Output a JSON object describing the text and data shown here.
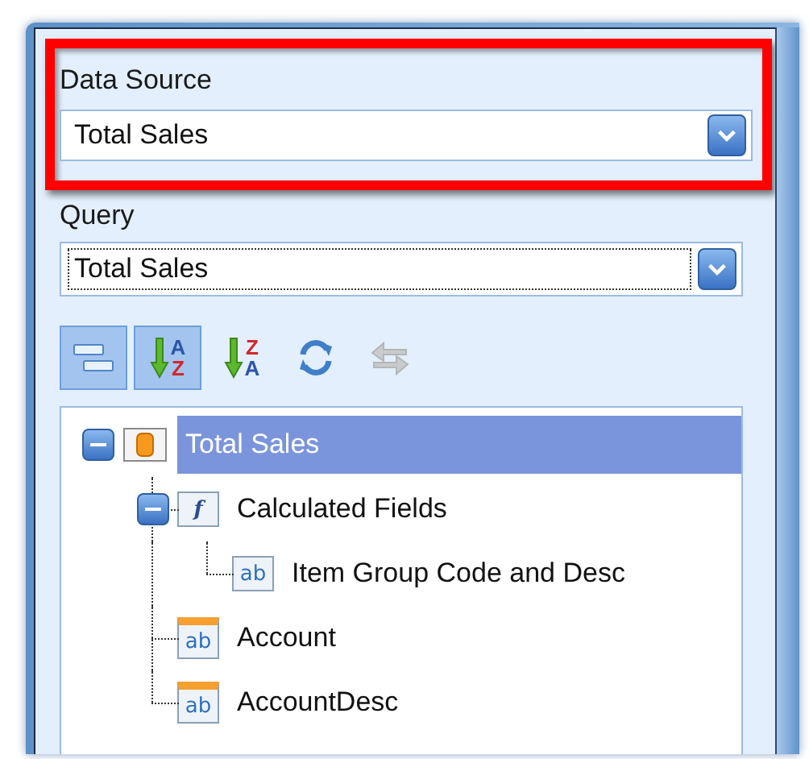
{
  "data_source": {
    "label": "Data Source",
    "value": "Total Sales",
    "highlighted": true
  },
  "query": {
    "label": "Query",
    "value": "Total Sales",
    "focused": true
  },
  "toolbar": [
    {
      "kind": "group",
      "selected": true,
      "disabled": false
    },
    {
      "kind": "sort",
      "letters": [
        {
          "text": "A",
          "color": "#2b56a8"
        },
        {
          "text": "Z",
          "color": "#d0282a"
        }
      ],
      "selected": true,
      "disabled": false
    },
    {
      "kind": "sort",
      "letters": [
        {
          "text": "Z",
          "color": "#d0282a"
        },
        {
          "text": "A",
          "color": "#2b56a8"
        }
      ],
      "selected": false,
      "disabled": false
    },
    {
      "kind": "refresh",
      "selected": false,
      "disabled": false
    },
    {
      "kind": "swap",
      "selected": false,
      "disabled": true
    }
  ],
  "tree": [
    {
      "label": "Total Sales",
      "kind": "table",
      "selected": true,
      "expanded": true,
      "children": [
        {
          "label": "Calculated Fields",
          "kind": "function",
          "icon_text": "f",
          "selected": false,
          "expanded": true,
          "children": [
            {
              "label": "Item Group Code and Desc",
              "kind": "calc-field",
              "icon_text": "ab",
              "selected": false
            }
          ]
        },
        {
          "label": "Account",
          "kind": "field",
          "icon_text": "ab",
          "selected": false
        },
        {
          "label": "AccountDesc",
          "kind": "field",
          "icon_text": "ab",
          "selected": false
        }
      ]
    }
  ]
}
